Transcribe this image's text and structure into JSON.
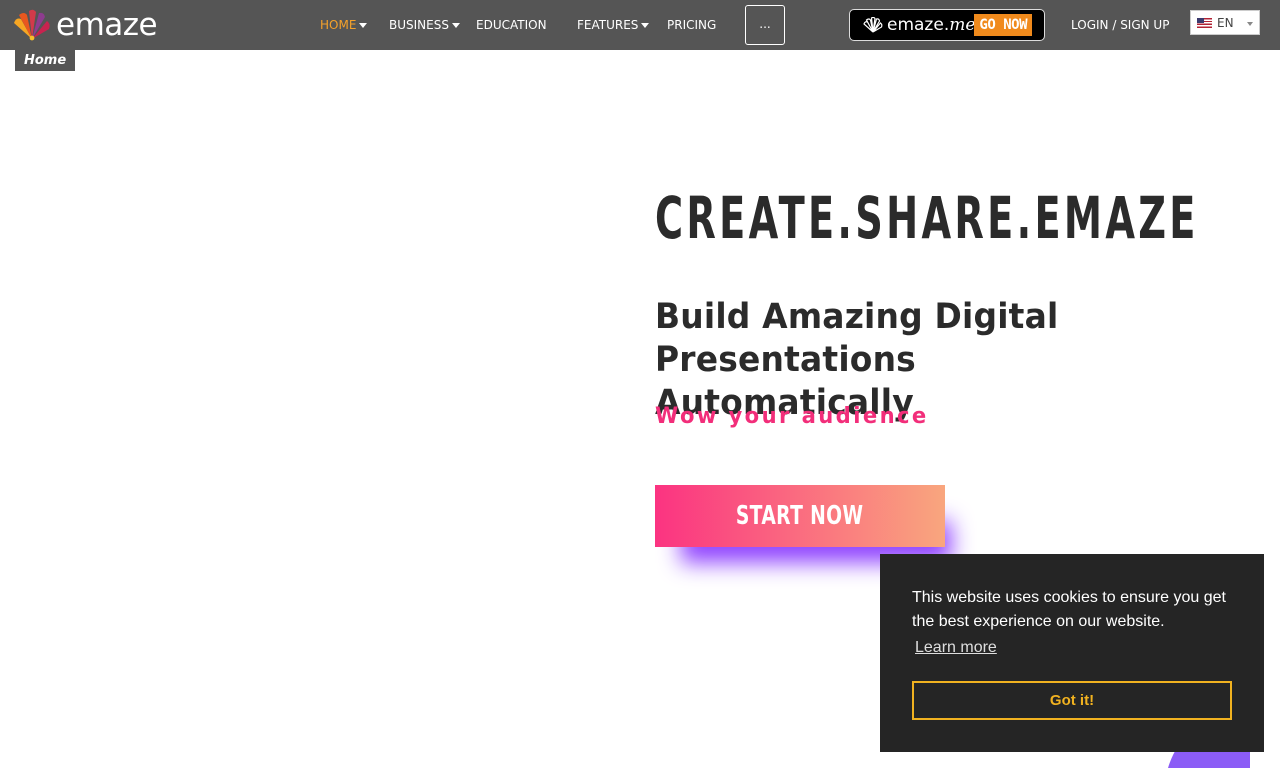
{
  "brand": {
    "logo_text": "emaze",
    "colors": {
      "nav_bg": "#555555",
      "nav_active": "#f4a12a",
      "accent_pink": "#f22e7a",
      "cta_gradient_start": "#fb3381",
      "cta_gradient_end": "#f9a67e",
      "cta_shadow": "#8c3cff",
      "cookie_bg": "#252525",
      "cookie_accent": "#f1b220"
    }
  },
  "nav": {
    "items": [
      {
        "label": "HOME",
        "active": true,
        "has_dropdown": true
      },
      {
        "label": "BUSINESS",
        "active": false,
        "has_dropdown": true
      },
      {
        "label": "EDUCATION",
        "active": false,
        "has_dropdown": false
      },
      {
        "label": "FEATURES",
        "active": false,
        "has_dropdown": true
      },
      {
        "label": "PRICING",
        "active": false,
        "has_dropdown": false
      }
    ],
    "more_label": "...",
    "emazeme": {
      "brand": "emaze.",
      "suffix": "me",
      "cta": "GO NOW"
    },
    "login_label": "LOGIN / SIGN UP",
    "language": {
      "selected": "EN",
      "flag_icon": "us-flag-icon"
    }
  },
  "breadcrumb": {
    "label": "Home"
  },
  "hero": {
    "title": "CREATE.SHARE.EMAZE",
    "subtitle": "Build Amazing Digital Presentations Automatically",
    "tagline": "Wow your audience",
    "cta_label": "START NOW"
  },
  "cookie": {
    "message": "This website uses cookies to ensure you get the best experience on our website.",
    "learn_more": "Learn more",
    "accept": "Got it!"
  }
}
